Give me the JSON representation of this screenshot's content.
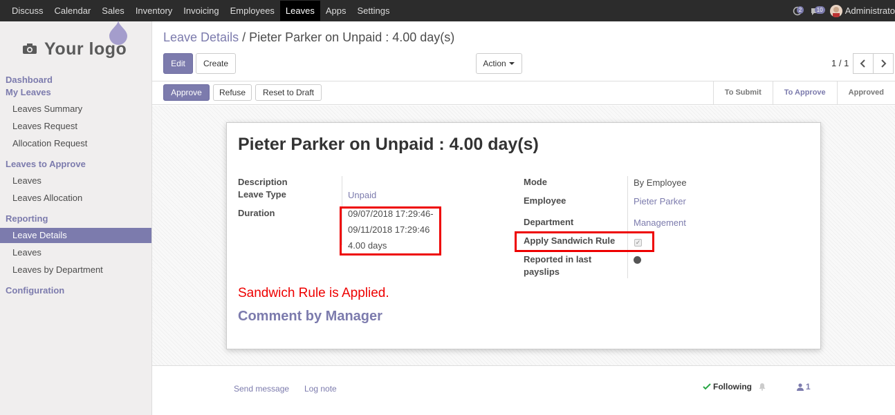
{
  "topbar": {
    "menu": [
      "Discuss",
      "Calendar",
      "Sales",
      "Inventory",
      "Invoicing",
      "Employees",
      "Leaves",
      "Apps",
      "Settings"
    ],
    "active": "Leaves",
    "activity_count": "2",
    "message_count": "10",
    "user": "Administrato"
  },
  "logo": {
    "text": "Your logo"
  },
  "sidebar": {
    "dashboard": "Dashboard",
    "my_leaves": "My Leaves",
    "leaves_summary": "Leaves Summary",
    "leaves_request": "Leaves Request",
    "allocation_request": "Allocation Request",
    "leaves_to_approve": "Leaves to Approve",
    "leaves": "Leaves",
    "leaves_allocation": "Leaves Allocation",
    "reporting": "Reporting",
    "leave_details": "Leave Details",
    "reporting_leaves": "Leaves",
    "leaves_by_department": "Leaves by Department",
    "configuration": "Configuration"
  },
  "breadcrumb": {
    "parent": "Leave Details",
    "separator": "/",
    "current": "Pieter Parker on Unpaid : 4.00 day(s)"
  },
  "control": {
    "edit": "Edit",
    "create": "Create",
    "action": "Action",
    "pager": "1 / 1"
  },
  "statusbar": {
    "approve": "Approve",
    "refuse": "Refuse",
    "reset": "Reset to Draft",
    "stages": [
      "To Submit",
      "To Approve",
      "Approved"
    ],
    "current_stage": "To Approve"
  },
  "form": {
    "title": "Pieter Parker on Unpaid : 4.00 day(s)",
    "description_label": "Description",
    "leave_type_label": "Leave Type",
    "leave_type": "Unpaid",
    "duration_label": "Duration",
    "date_from": "09/07/2018 17:29:46",
    "date_sep": "-",
    "date_to": "09/11/2018 17:29:46",
    "days": "4.00 days",
    "mode_label": "Mode",
    "mode": "By Employee",
    "employee_label": "Employee",
    "employee": "Pieter Parker",
    "department_label": "Department",
    "department": "Management",
    "sandwich_label": "Apply Sandwich Rule",
    "sandwich_checked": true,
    "reported_label_1": "Reported in last",
    "reported_label_2": "payslips",
    "notice": "Sandwich Rule is Applied.",
    "comment_heading": "Comment by Manager"
  },
  "chatter": {
    "send_message": "Send message",
    "log_note": "Log note",
    "following": "Following",
    "followers": "1"
  },
  "colors": {
    "primary": "#7c7bad",
    "highlight": "#e00000",
    "navbar": "#2c2c2c"
  }
}
